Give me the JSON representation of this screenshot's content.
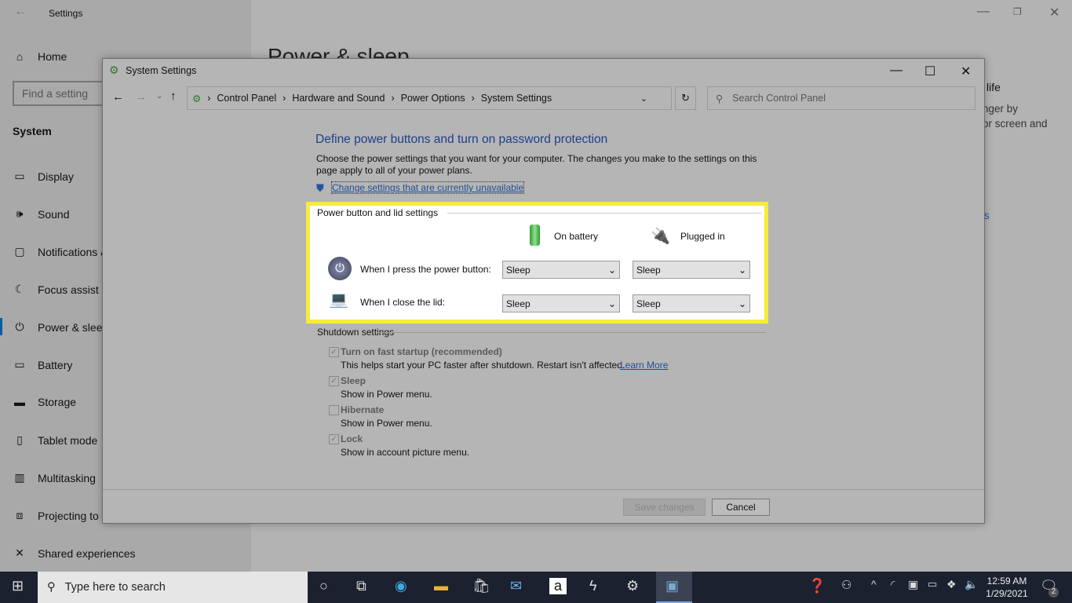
{
  "settings": {
    "title": "Settings",
    "home": "Home",
    "search_placeholder": "Find a setting",
    "section": "System",
    "items": [
      {
        "label": "Display",
        "icon": "monitor-icon"
      },
      {
        "label": "Sound",
        "icon": "speaker-icon"
      },
      {
        "label": "Notifications &",
        "icon": "notification-icon"
      },
      {
        "label": "Focus assist",
        "icon": "moon-icon"
      },
      {
        "label": "Power & sleep",
        "icon": "power-icon"
      },
      {
        "label": "Battery",
        "icon": "battery-icon"
      },
      {
        "label": "Storage",
        "icon": "storage-icon"
      },
      {
        "label": "Tablet mode",
        "icon": "tablet-icon"
      },
      {
        "label": "Multitasking",
        "icon": "multitasking-icon"
      },
      {
        "label": "Projecting to t",
        "icon": "projecting-icon"
      },
      {
        "label": "Shared experiences",
        "icon": "shared-icon"
      }
    ],
    "page_title": "Power & sleep",
    "right_heading": "life",
    "right_text1": "nger by",
    "right_text2": "or screen and",
    "right_link": "s"
  },
  "dialog": {
    "title": "System Settings",
    "breadcrumb": [
      "Control Panel",
      "Hardware and Sound",
      "Power Options",
      "System Settings"
    ],
    "search_placeholder": "Search Control Panel",
    "heading": "Define power buttons and turn on password protection",
    "description": "Choose the power settings that you want for your computer. The changes you make to the settings on this page apply to all of your power plans.",
    "change_link": "Change settings that are currently unavailable",
    "group_title": "Power button and lid settings",
    "col_battery": "On battery",
    "col_plugged": "Plugged in",
    "rows": [
      {
        "label": "When I press the power button:",
        "battery": "Sleep",
        "plugged": "Sleep"
      },
      {
        "label": "When I close the lid:",
        "battery": "Sleep",
        "plugged": "Sleep"
      }
    ],
    "shutdown_title": "Shutdown settings",
    "shutdown": [
      {
        "label": "Turn on fast startup (recommended)",
        "desc": "This helps start your PC faster after shutdown. Restart isn't affected.",
        "checked": true
      },
      {
        "label": "Sleep",
        "desc": "Show in Power menu.",
        "checked": true
      },
      {
        "label": "Hibernate",
        "desc": "Show in Power menu.",
        "checked": false
      },
      {
        "label": "Lock",
        "desc": "Show in account picture menu.",
        "checked": true
      }
    ],
    "learn_more": "Learn More",
    "save": "Save changes",
    "cancel": "Cancel",
    "highlight_color": "#f6ec3c"
  },
  "taskbar": {
    "search_placeholder": "Type here to search",
    "time": "12:59 AM",
    "date": "1/29/2021",
    "notifications": "2"
  }
}
